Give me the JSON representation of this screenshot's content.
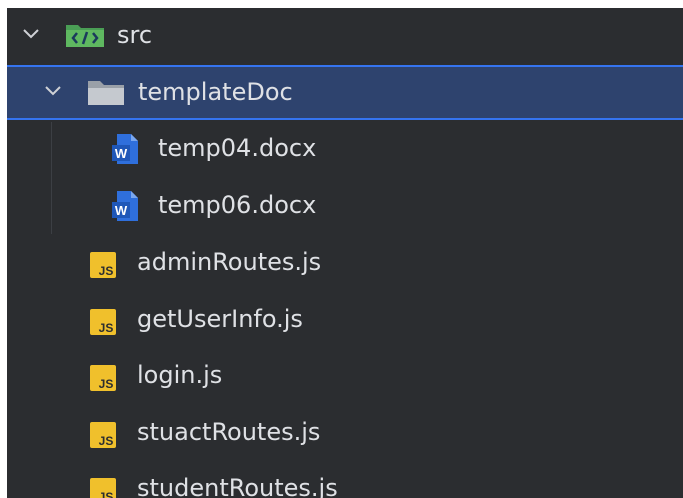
{
  "project_tree": {
    "src": {
      "label": "src",
      "icon": "source-folder-icon",
      "expanded": true
    },
    "templateDoc": {
      "label": "templateDoc",
      "icon": "folder-icon",
      "expanded": true,
      "selected": true
    },
    "files": [
      {
        "label": "temp04.docx",
        "icon": "word-document-icon"
      },
      {
        "label": "temp06.docx",
        "icon": "word-document-icon"
      },
      {
        "label": "adminRoutes.js",
        "icon": "javascript-file-icon"
      },
      {
        "label": "getUserInfo.js",
        "icon": "javascript-file-icon"
      },
      {
        "label": "login.js",
        "icon": "javascript-file-icon"
      },
      {
        "label": "stuactRoutes.js",
        "icon": "javascript-file-icon"
      },
      {
        "label": "studentRoutes.js",
        "icon": "javascript-file-icon"
      }
    ],
    "js_badge_text": "JS",
    "word_badge_text": "W"
  },
  "colors": {
    "panel_background": "#2b2d30",
    "text": "#dfe1e5",
    "selection_background": "#2e436e",
    "selection_border": "#3574f0",
    "js_icon": "#f0c02c",
    "word_icon": "#2f6fdc",
    "source_folder_icon": "#5fb860"
  }
}
